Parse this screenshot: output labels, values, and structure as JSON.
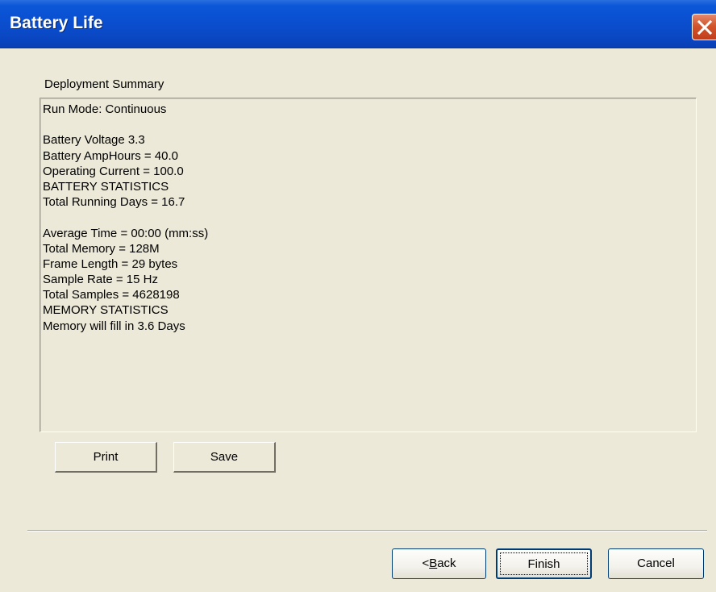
{
  "window": {
    "title": "Battery Life"
  },
  "summary": {
    "label": "Deployment Summary",
    "lines": [
      "Run Mode: Continuous",
      "",
      "Battery Voltage 3.3",
      "Battery AmpHours = 40.0",
      "Operating Current = 100.0",
      "BATTERY STATISTICS",
      "Total Running Days = 16.7",
      "",
      "Average Time = 00:00 (mm:ss)",
      "Total Memory = 128M",
      "Frame Length = 29 bytes",
      "Sample Rate = 15 Hz",
      "Total Samples = 4628198",
      "MEMORY STATISTICS",
      "Memory will fill in 3.6 Days"
    ]
  },
  "actions": {
    "print_label": "Print",
    "save_label": "Save"
  },
  "wizard": {
    "back_prefix": "< ",
    "back_accel": "B",
    "back_rest": "ack",
    "finish_label": "Finish",
    "cancel_label": "Cancel"
  }
}
